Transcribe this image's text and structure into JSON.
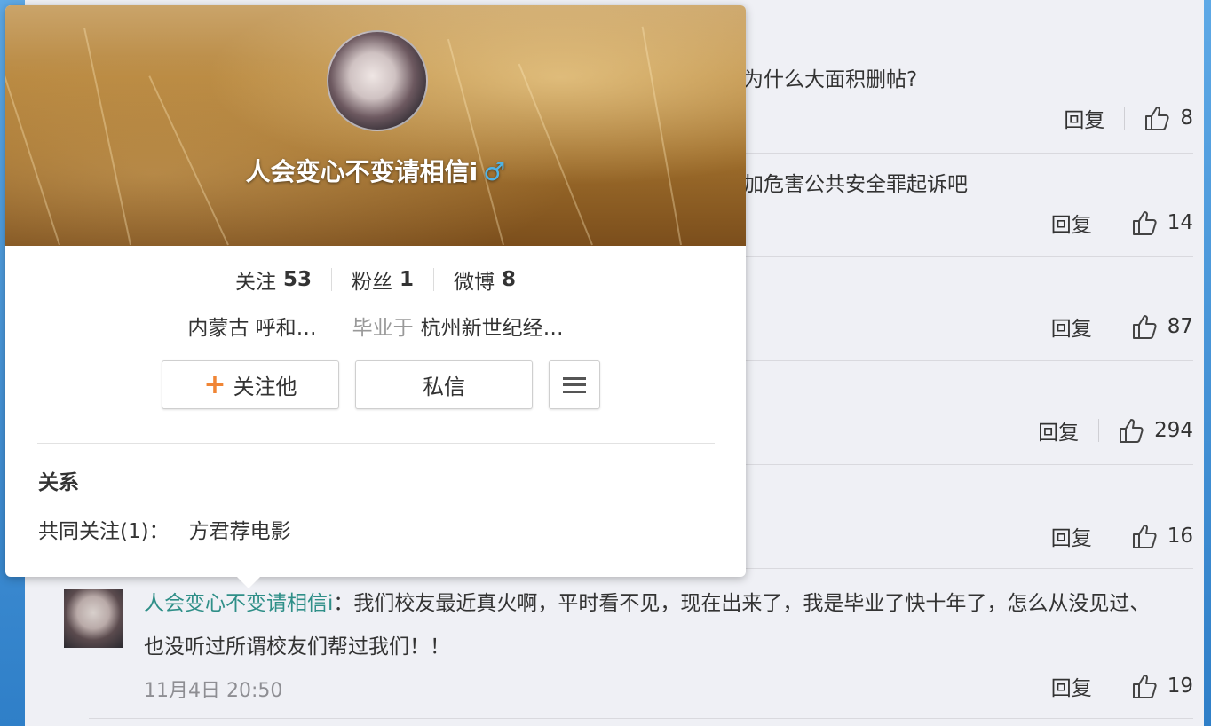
{
  "comments": [
    {
      "text": "为什么大面积删帖?",
      "reply": "回复",
      "likes": "8"
    },
    {
      "text": "加危害公共安全罪起诉吧",
      "reply": "回复",
      "likes": "14"
    },
    {
      "text": "",
      "reply": "回复",
      "likes": "87"
    },
    {
      "text": "",
      "reply": "回复",
      "likes": "294"
    },
    {
      "text": "",
      "reply": "回复",
      "likes": "16"
    }
  ],
  "main_comment": {
    "user": "人会变心不变请相信i",
    "colon": "：",
    "text": "我们校友最近真火啊，平时看不见，现在出来了，我是毕业了快十年了，怎么从没见过、也没听过所谓校友们帮过我们！！",
    "time": "11月4日 20:50",
    "reply": "回复",
    "likes": "19"
  },
  "profile_card": {
    "name": "人会变心不变请相信i",
    "gender_symbol": "♂",
    "stats": {
      "following_label": "关注",
      "following": "53",
      "fans_label": "粉丝",
      "fans": "1",
      "weibo_label": "微博",
      "weibo": "8"
    },
    "location": "内蒙古 呼和…",
    "education_label": "毕业于",
    "school": "杭州新世纪经…",
    "follow_button": "关注他",
    "message_button": "私信",
    "relation_title": "关系",
    "mutual_label": "共同关注(1)：",
    "mutual_name": "方君荐电影"
  },
  "colors": {
    "accent_orange": "#f08535",
    "username_teal": "#2f8f88",
    "gender_blue": "#4fb4e8"
  }
}
